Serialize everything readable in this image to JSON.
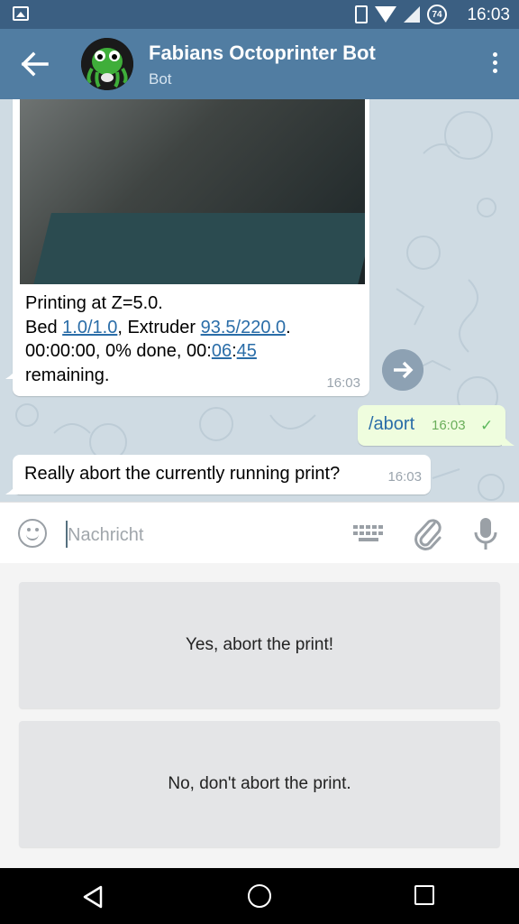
{
  "status_bar": {
    "time": "16:03",
    "battery": "74"
  },
  "header": {
    "title": "Fabians Octoprinter Bot",
    "subtitle": "Bot"
  },
  "messages": {
    "incoming_photo": {
      "line1": "Printing at Z=5.0.",
      "bed_prefix": "Bed ",
      "bed_value": "1.0/1.0",
      "extruder_prefix": ", Extruder ",
      "extruder_value": "93.5/220.0",
      "extruder_suffix": ".",
      "progress_prefix": "00:00:00, 0% done, 00:",
      "remaining_min": "06",
      "colon": ":",
      "remaining_sec": "45",
      "line4": "remaining.",
      "time": "16:03"
    },
    "outgoing": {
      "text": "/abort",
      "time": "16:03"
    },
    "incoming_question": {
      "text": "Really abort the currently running print?",
      "time": "16:03"
    }
  },
  "input": {
    "placeholder": "Nachricht"
  },
  "keyboard_buttons": {
    "yes": "Yes, abort the print!",
    "no": "No, don't abort the print."
  },
  "colors": {
    "app_bar": "#517da2",
    "status_bar": "#3b5f82",
    "link": "#2a6da8",
    "outgoing_bubble": "#effdde"
  },
  "icons": [
    "back-arrow-icon",
    "more-vert-icon",
    "share-icon",
    "emoji-icon",
    "keyboard-icon",
    "attach-icon",
    "mic-icon",
    "check-icon",
    "nav-back-icon",
    "nav-home-icon",
    "nav-recents-icon"
  ]
}
